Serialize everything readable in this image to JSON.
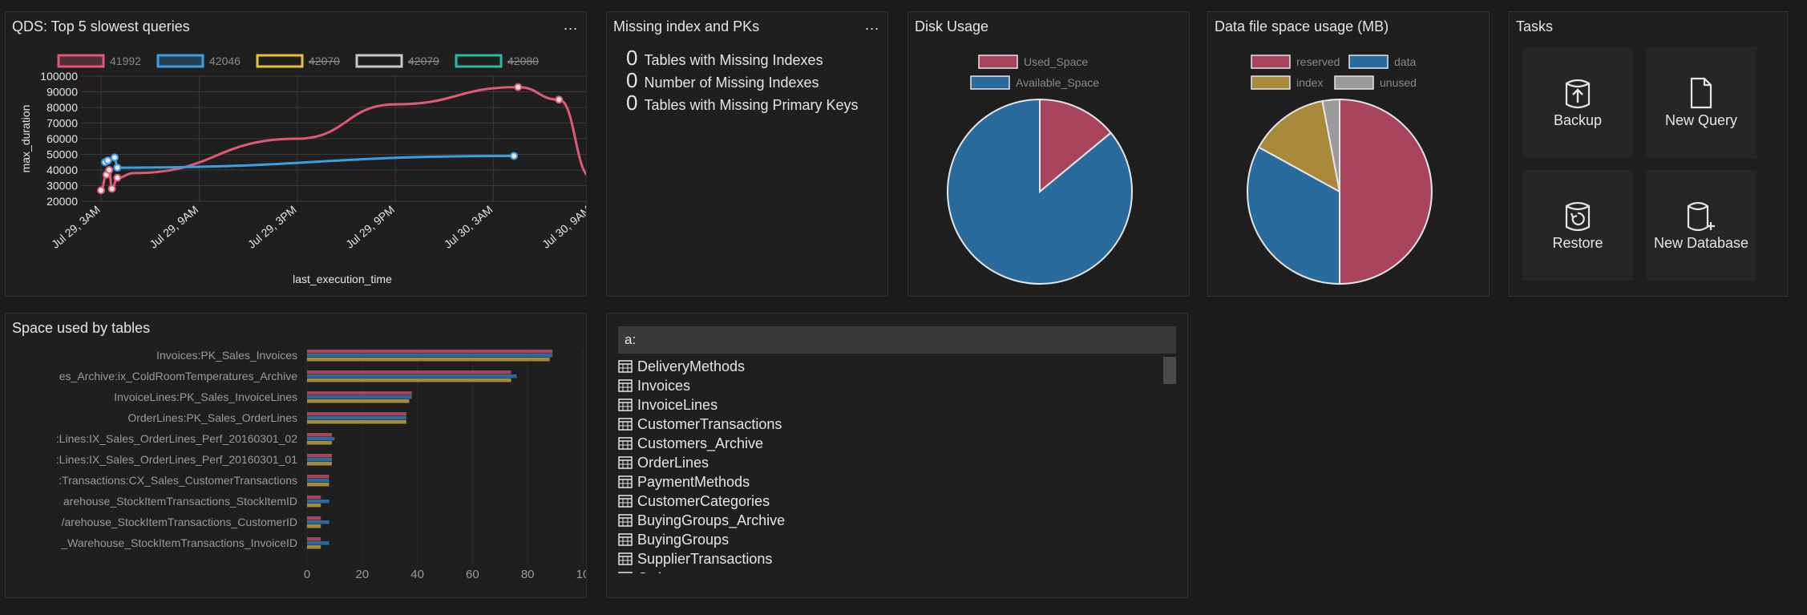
{
  "qds": {
    "title": "QDS: Top 5 slowest queries",
    "menu": "...",
    "chart_data": {
      "type": "line",
      "title": "QDS: Top 5 slowest queries",
      "xlabel": "last_execution_time",
      "ylabel": "max_duration",
      "ylim": [
        20000,
        100000
      ],
      "y_ticks": [
        "20000",
        "30000",
        "40000",
        "50000",
        "60000",
        "70000",
        "80000",
        "90000",
        "100000"
      ],
      "x_ticks": [
        "Jul 29, 3AM",
        "Jul 29, 9AM",
        "Jul 29, 3PM",
        "Jul 29, 9PM",
        "Jul 30, 3AM",
        "Jul 30, 9AM"
      ],
      "grid": true,
      "legend_position": "top",
      "series": [
        {
          "name": "41992",
          "color": "#e05a78",
          "enabled": true,
          "x": [
            "Jul 29, 3:00AM",
            "Jul 29, 3:20AM",
            "Jul 29, 3:30AM",
            "Jul 29, 3:40AM",
            "Jul 29, 4:00AM",
            "Jul 29, 5:00AM",
            "Jul 29, 3PM",
            "Jul 29, 9PM",
            "Jul 30, 4:30AM",
            "Jul 30, 7:00AM",
            "Jul 30, 9:00AM"
          ],
          "values": [
            27000,
            37000,
            40000,
            28000,
            35000,
            38000,
            60000,
            82000,
            93000,
            85000,
            35000
          ]
        },
        {
          "name": "42046",
          "color": "#3c9fe0",
          "enabled": true,
          "x": [
            "Jul 29, 3:15AM",
            "Jul 29, 3:25AM",
            "Jul 29, 3:50AM",
            "Jul 29, 4:00AM",
            "Jul 30, 4:15AM"
          ],
          "values": [
            45000,
            46000,
            48000,
            41500,
            49000
          ]
        },
        {
          "name": "42070",
          "color": "#e8c23a",
          "enabled": false
        },
        {
          "name": "42079",
          "color": "#c8c8c8",
          "enabled": false
        },
        {
          "name": "42080",
          "color": "#2eb8a8",
          "enabled": false
        }
      ]
    }
  },
  "missing_index": {
    "title": "Missing index and PKs",
    "menu": "...",
    "rows": [
      {
        "value": "0",
        "label": "Tables with Missing Indexes"
      },
      {
        "value": "0",
        "label": "Number of Missing Indexes"
      },
      {
        "value": "0",
        "label": "Tables with Missing Primary Keys"
      }
    ]
  },
  "disk_usage": {
    "title": "Disk Usage",
    "chart_data": {
      "type": "pie",
      "title": "Disk Usage",
      "legend_position": "top",
      "slices": [
        {
          "name": "Used_Space",
          "value": 14,
          "color": "#a8445e"
        },
        {
          "name": "Available_Space",
          "value": 86,
          "color": "#2a6b9e"
        }
      ]
    }
  },
  "data_file": {
    "title": "Data file space usage (MB)",
    "chart_data": {
      "type": "pie",
      "title": "Data file space usage (MB)",
      "legend_position": "top",
      "slices": [
        {
          "name": "reserved",
          "value": 50,
          "color": "#a8445e"
        },
        {
          "name": "data",
          "value": 33,
          "color": "#2a6b9e"
        },
        {
          "name": "index",
          "value": 14,
          "color": "#a8893a"
        },
        {
          "name": "unused",
          "value": 3,
          "color": "#9a9a9a"
        }
      ]
    }
  },
  "tasks": {
    "title": "Tasks",
    "items": [
      {
        "label": "Backup",
        "icon": "backup-icon"
      },
      {
        "label": "New Query",
        "icon": "new-query-icon"
      },
      {
        "label": "Restore",
        "icon": "restore-icon"
      },
      {
        "label": "New Database",
        "icon": "new-database-icon"
      }
    ]
  },
  "space_tables": {
    "title": "Space used by tables",
    "chart_data": {
      "type": "bar",
      "orientation": "horizontal",
      "title": "Space used by tables",
      "xlim": [
        0,
        100
      ],
      "x_ticks": [
        "0",
        "20",
        "40",
        "60",
        "80",
        "10"
      ],
      "categories": [
        "Invoices:PK_Sales_Invoices",
        "es_Archive:ix_ColdRoomTemperatures_Archive",
        "InvoiceLines:PK_Sales_InvoiceLines",
        "OrderLines:PK_Sales_OrderLines",
        ":Lines:IX_Sales_OrderLines_Perf_20160301_02",
        ":Lines:IX_Sales_OrderLines_Perf_20160301_01",
        ":Transactions:CX_Sales_CustomerTransactions",
        "arehouse_StockItemTransactions_StockItemID",
        "/arehouse_StockItemTransactions_CustomerID",
        "_Warehouse_StockItemTransactions_InvoiceID"
      ],
      "series": [
        {
          "color": "#a8445e",
          "values": [
            89,
            74,
            38,
            36,
            9,
            9,
            8,
            5,
            5,
            5
          ]
        },
        {
          "color": "#2a6b9e",
          "values": [
            89,
            76,
            38,
            36,
            10,
            9,
            8,
            8,
            8,
            8
          ]
        },
        {
          "color": "#a8893a",
          "values": [
            88,
            74,
            37,
            36,
            9,
            9,
            8,
            5,
            5,
            5
          ]
        }
      ]
    }
  },
  "table_list": {
    "search_value": "a:",
    "items": [
      "DeliveryMethods",
      "Invoices",
      "InvoiceLines",
      "CustomerTransactions",
      "Customers_Archive",
      "OrderLines",
      "PaymentMethods",
      "CustomerCategories",
      "BuyingGroups_Archive",
      "BuyingGroups",
      "SupplierTransactions",
      "Orders"
    ]
  }
}
